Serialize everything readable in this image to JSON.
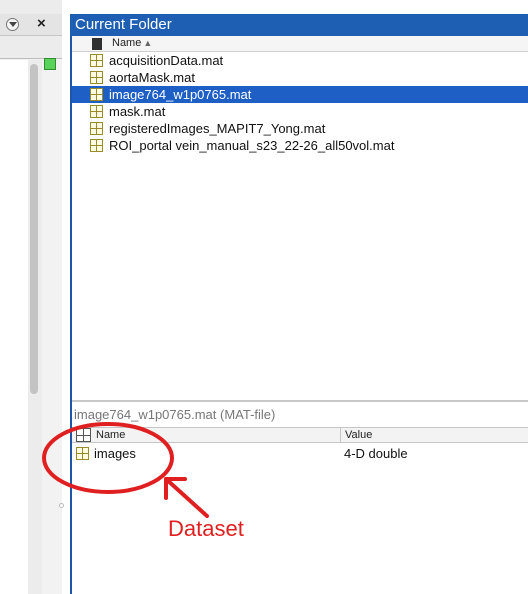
{
  "colors": {
    "title_bar": "#1e5fb4",
    "selection": "#1e5fc6",
    "annotation": "#e02020",
    "status_indicator": "#5bd25b"
  },
  "left_panel": {
    "icons": [
      "dropdown-icon",
      "close-icon",
      "status-square"
    ],
    "close_glyph": "×"
  },
  "folder": {
    "title": "Current Folder",
    "column_name": "Name",
    "sort_indicator": "▲",
    "files": [
      {
        "name": "acquisitionData.mat",
        "selected": false
      },
      {
        "name": "aortaMask.mat",
        "selected": false
      },
      {
        "name": "image764_w1p0765.mat",
        "selected": true
      },
      {
        "name": "mask.mat",
        "selected": false
      },
      {
        "name": "registeredImages_MAPIT7_Yong.mat",
        "selected": false
      },
      {
        "name": "ROI_portal vein_manual_s23_22-26_all50vol.mat",
        "selected": false
      }
    ]
  },
  "details": {
    "title": "image764_w1p0765.mat  (MAT-file)",
    "columns": {
      "name": "Name",
      "value": "Value"
    },
    "variables": [
      {
        "name": "images",
        "value": "4-D double"
      }
    ]
  },
  "annotation": {
    "label": "Dataset"
  }
}
